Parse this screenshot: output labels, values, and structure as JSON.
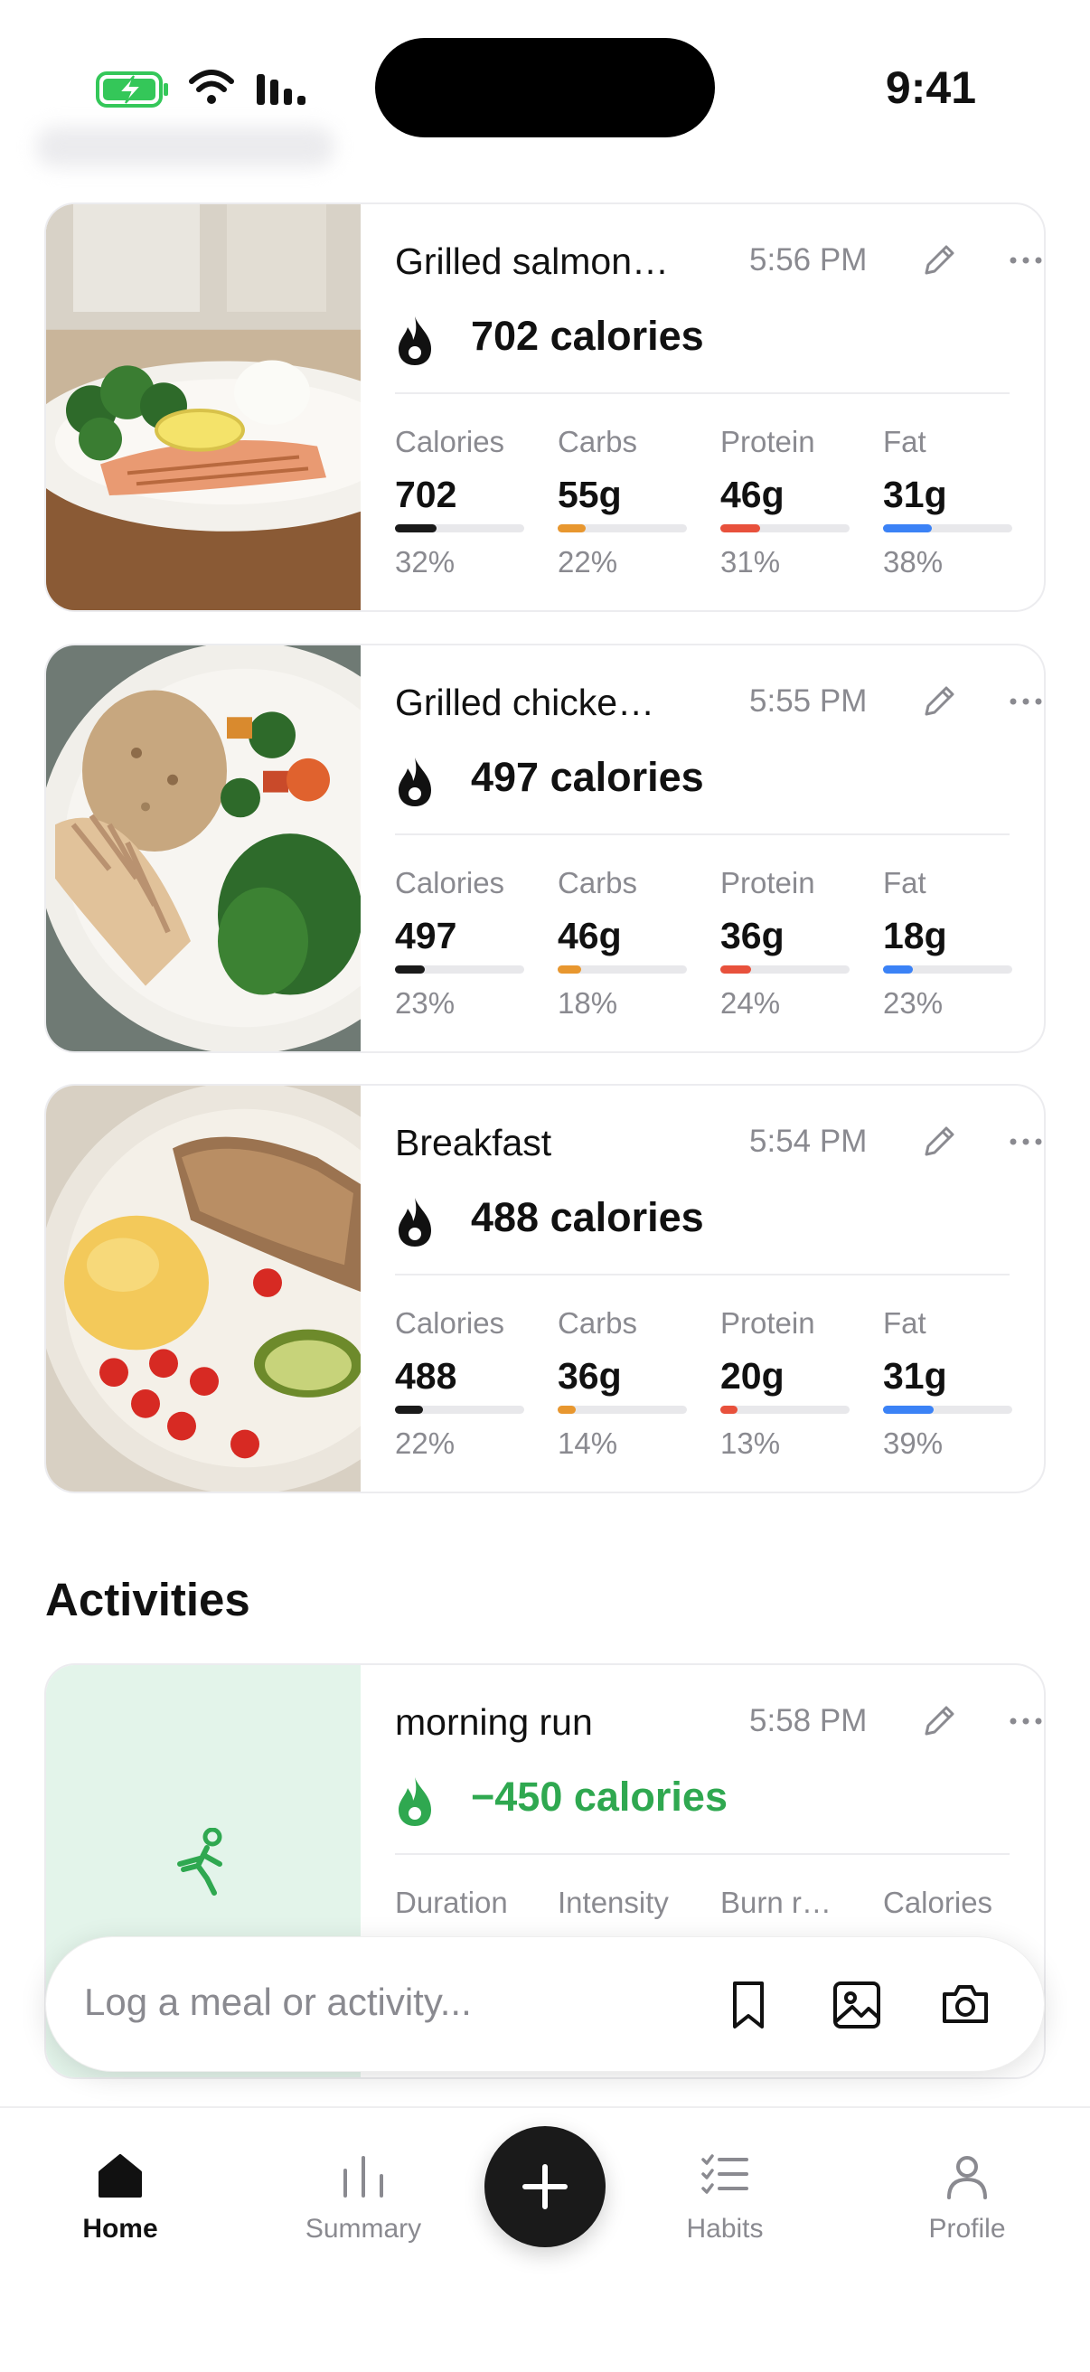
{
  "status_bar": {
    "time": "9:41"
  },
  "meals": [
    {
      "title": "Grilled salmon…",
      "time": "5:56 PM",
      "calories_label": "702 calories",
      "macros": [
        {
          "label": "Calories",
          "value": "702",
          "pct": "32%",
          "fraction": 0.32,
          "color": "#1a1a1a"
        },
        {
          "label": "Carbs",
          "value": "55g",
          "pct": "22%",
          "fraction": 0.22,
          "color": "#e8972f"
        },
        {
          "label": "Protein",
          "value": "46g",
          "pct": "31%",
          "fraction": 0.31,
          "color": "#e8513c"
        },
        {
          "label": "Fat",
          "value": "31g",
          "pct": "38%",
          "fraction": 0.38,
          "color": "#3b82f6"
        }
      ]
    },
    {
      "title": "Grilled chicke…",
      "time": "5:55 PM",
      "calories_label": "497 calories",
      "macros": [
        {
          "label": "Calories",
          "value": "497",
          "pct": "23%",
          "fraction": 0.23,
          "color": "#1a1a1a"
        },
        {
          "label": "Carbs",
          "value": "46g",
          "pct": "18%",
          "fraction": 0.18,
          "color": "#e8972f"
        },
        {
          "label": "Protein",
          "value": "36g",
          "pct": "24%",
          "fraction": 0.24,
          "color": "#e8513c"
        },
        {
          "label": "Fat",
          "value": "18g",
          "pct": "23%",
          "fraction": 0.23,
          "color": "#3b82f6"
        }
      ]
    },
    {
      "title": "Breakfast",
      "time": "5:54 PM",
      "calories_label": "488 calories",
      "macros": [
        {
          "label": "Calories",
          "value": "488",
          "pct": "22%",
          "fraction": 0.22,
          "color": "#1a1a1a"
        },
        {
          "label": "Carbs",
          "value": "36g",
          "pct": "14%",
          "fraction": 0.14,
          "color": "#e8972f"
        },
        {
          "label": "Protein",
          "value": "20g",
          "pct": "13%",
          "fraction": 0.13,
          "color": "#e8513c"
        },
        {
          "label": "Fat",
          "value": "31g",
          "pct": "39%",
          "fraction": 0.39,
          "color": "#3b82f6"
        }
      ]
    }
  ],
  "activities": {
    "section_title": "Activities",
    "items": [
      {
        "title": "morning run",
        "time": "5:58 PM",
        "calories_label": "−450 calories",
        "columns": [
          "Duration",
          "Intensity",
          "Burn r…",
          "Calories"
        ]
      }
    ]
  },
  "input_bar": {
    "placeholder": "Log a meal or activity..."
  },
  "tabbar": {
    "items": [
      {
        "label": "Home",
        "icon": "home-icon",
        "active": true
      },
      {
        "label": "Summary",
        "icon": "summary-icon",
        "active": false
      },
      {
        "label": "Habits",
        "icon": "habits-icon",
        "active": false
      },
      {
        "label": "Profile",
        "icon": "profile-icon",
        "active": false
      }
    ]
  },
  "colors": {
    "accent_green": "#2fa850",
    "fab": "#1a1a1a",
    "battery_green": "#34c759"
  }
}
